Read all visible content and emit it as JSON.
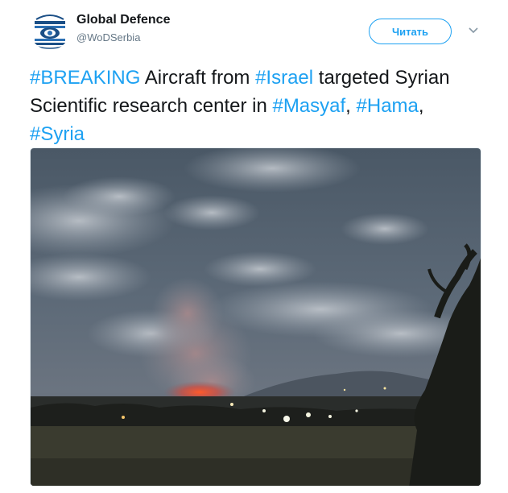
{
  "author": {
    "name": "Global Defence",
    "handle": "@WoDSerbia",
    "avatar_icon": "globe-logo-icon"
  },
  "actions": {
    "follow_label": "Читать",
    "menu_icon": "chevron-down-icon"
  },
  "tweet": {
    "segments": [
      {
        "text": "#BREAKING",
        "hashtag": true
      },
      {
        "text": " Aircraft from ",
        "hashtag": false
      },
      {
        "text": "#Israel",
        "hashtag": true
      },
      {
        "text": " targeted Syrian Scientific research center in ",
        "hashtag": false
      },
      {
        "text": "#Masyaf",
        "hashtag": true
      },
      {
        "text": ", ",
        "hashtag": false
      },
      {
        "text": "#Hama",
        "hashtag": true
      },
      {
        "text": ", ",
        "hashtag": false
      },
      {
        "text": "#Syria",
        "hashtag": true
      }
    ]
  },
  "colors": {
    "accent": "#1da1f2",
    "text": "#14171a",
    "secondary": "#657786"
  }
}
